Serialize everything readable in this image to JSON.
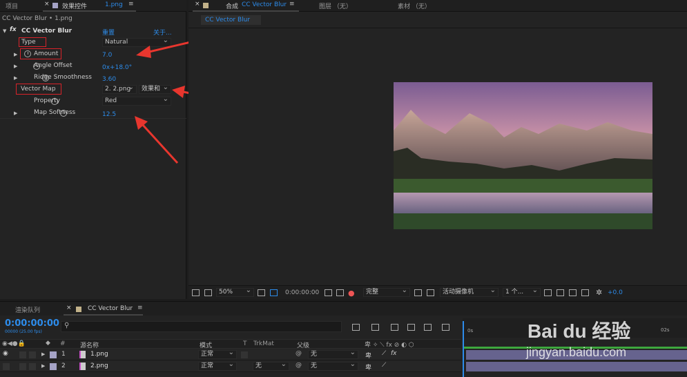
{
  "left_panel": {
    "tab_project": "项目",
    "tab_effect_controls": "效果控件",
    "tab_effect_file": "1.png",
    "subtitle": "CC Vector Blur • 1.png",
    "effect_name": "CC Vector Blur",
    "reset_label": "重置",
    "about_label": "关于...",
    "fx_label": "fx",
    "rows": {
      "type_label": "Type",
      "type_value": "Natural",
      "amount_label": "Amount",
      "amount_value": "7.0",
      "angle_label": "Angle Offset",
      "angle_value": "0x+18.0°",
      "ridge_label": "Ridge Smoothness",
      "ridge_value": "3.60",
      "vector_map_label": "Vector Map",
      "vector_map_value": "2. 2.png",
      "vector_map_value2": "效果和",
      "property_label": "Property",
      "property_value": "Red",
      "softness_label": "Map Softness",
      "softness_value": "12.5"
    }
  },
  "viewer": {
    "tab_comp_prefix": "合成",
    "tab_comp_name": "CC Vector Blur",
    "tab_layer": "图层 （无）",
    "tab_footage": "素材 （无）",
    "comp_button": "CC Vector Blur",
    "toolbar": {
      "zoom": "50%",
      "timecode": "0:00:00:00",
      "quality": "完整",
      "camera": "活动摄像机",
      "views": "1 个...",
      "exposure": "+0.0"
    }
  },
  "timeline": {
    "tab_render": "渲染队列",
    "tab_comp": "CC Vector Blur",
    "timecode": "0:00:00:00",
    "frame_info": "00000 (25.00 fps)",
    "search_placeholder": "",
    "ruler_start": "0s",
    "ruler_mark": "02s",
    "headers": {
      "hash": "#",
      "source": "源名称",
      "mode": "模式",
      "t": "T",
      "trkmat": "TrkMat",
      "parent": "父级"
    },
    "layers": [
      {
        "num": "1",
        "name": "1.png",
        "mode": "正常",
        "trkmat": "",
        "parent": "无"
      },
      {
        "num": "2",
        "name": "2.png",
        "mode": "正常",
        "trkmat": "无",
        "parent": "无"
      }
    ]
  },
  "watermark": {
    "brand": "Bai du 经验",
    "url": "jingyan.baidu.com"
  },
  "colors": {
    "accent_blue": "#2d8ceb",
    "annotation_red": "#e8362e",
    "layer_label": "#a5a3c6",
    "timeline_green": "#3ea83e"
  }
}
